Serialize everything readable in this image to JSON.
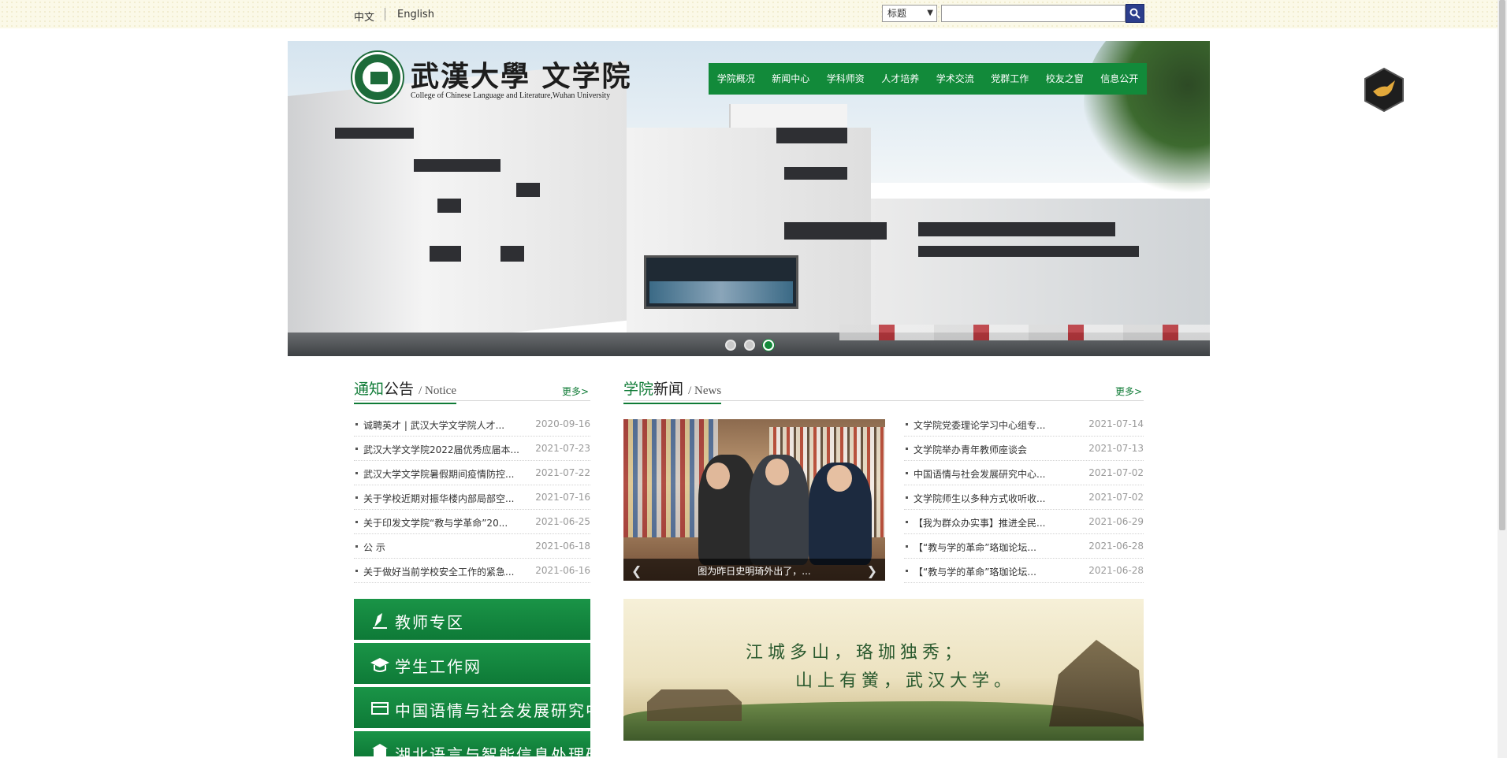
{
  "topbar": {
    "lang_zh": "中文",
    "lang_en": "English",
    "search_scope": "标题",
    "search_value": ""
  },
  "hero": {
    "logo_title": "武漢大學 文学院",
    "logo_subtitle": "College of Chinese Language and Literature,Wuhan University",
    "nav": [
      "学院概况",
      "新闻中心",
      "学科师资",
      "人才培养",
      "学术交流",
      "党群工作",
      "校友之窗",
      "信息公开"
    ],
    "slide_count": 3,
    "active_slide": 3
  },
  "notice": {
    "title_a": "通知",
    "title_b": "公告",
    "title_en": "/ Notice",
    "more": "更多>",
    "items": [
      {
        "title": "诚聘英才 | 武汉大学文学院人才...",
        "date": "2020-09-16"
      },
      {
        "title": "武汉大学文学院2022届优秀应届本...",
        "date": "2021-07-23"
      },
      {
        "title": "武汉大学文学院暑假期间疫情防控...",
        "date": "2021-07-22"
      },
      {
        "title": "关于学校近期对振华楼内部局部空...",
        "date": "2021-07-16"
      },
      {
        "title": "关于印发文学院“教与学革命”20...",
        "date": "2021-06-25"
      },
      {
        "title": "公 示",
        "date": "2021-06-18"
      },
      {
        "title": "关于做好当前学校安全工作的紧急...",
        "date": "2021-06-16"
      }
    ]
  },
  "news": {
    "title_a": "学院",
    "title_b": "新闻",
    "title_en": "/ News",
    "more": "更多>",
    "photo_caption": "图为昨日史明琦外出了，...",
    "items": [
      {
        "title": "文学院党委理论学习中心组专...",
        "date": "2021-07-14"
      },
      {
        "title": "文学院举办青年教师座谈会",
        "date": "2021-07-13"
      },
      {
        "title": "中国语情与社会发展研究中心...",
        "date": "2021-07-02"
      },
      {
        "title": "文学院师生以多种方式收听收...",
        "date": "2021-07-02"
      },
      {
        "title": "【我为群众办实事】推进全民...",
        "date": "2021-06-29"
      },
      {
        "title": "【“教与学的革命”珞珈论坛...",
        "date": "2021-06-28"
      },
      {
        "title": "【“教与学的革命”珞珈论坛...",
        "date": "2021-06-28"
      }
    ]
  },
  "quicklinks": [
    {
      "label": "教师专区",
      "icon": "pen-icon"
    },
    {
      "label": "学生工作网",
      "icon": "graduation-cap-icon"
    },
    {
      "label": "中国语情与社会发展研究中心",
      "icon": "book-icon"
    },
    {
      "label": "湖北语言与智能信息处理研究基地",
      "icon": "building-icon"
    }
  ],
  "banner": {
    "line1": "江城多山，珞珈独秀；",
    "line2": "山上有黉，武汉大学。"
  },
  "colors": {
    "brand_green": "#128a3a",
    "search_button": "#2c3e8c",
    "topbar_bg": "#fbf9e8"
  }
}
